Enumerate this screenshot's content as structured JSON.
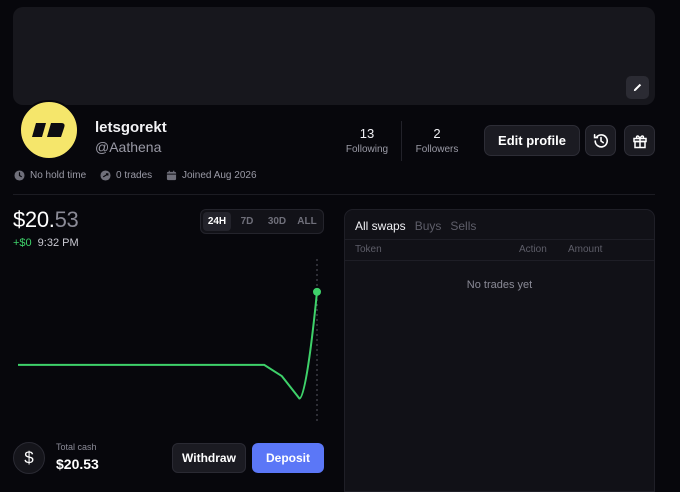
{
  "profile": {
    "username": "letsgorekt",
    "handle": "@Aathena",
    "following_count": "13",
    "following_label": "Following",
    "followers_count": "2",
    "followers_label": "Followers",
    "edit_profile_label": "Edit profile",
    "meta": {
      "hold_time": "No hold time",
      "trades": "0 trades",
      "joined": "Joined Aug 2026"
    }
  },
  "portfolio": {
    "balance_main": "$20.",
    "balance_cents": "53",
    "change": "+$0",
    "time": "9:32 PM",
    "range_options": [
      "24H",
      "7D",
      "30D",
      "ALL"
    ],
    "selected_range": "24H",
    "total_cash_label": "Total cash",
    "total_cash_value": "$20.53",
    "withdraw_label": "Withdraw",
    "deposit_label": "Deposit"
  },
  "chart_data": {
    "type": "line",
    "title": "",
    "series": [
      {
        "values": [
          20.4,
          20.4,
          20.4,
          20.4,
          20.4,
          20.4,
          20.4,
          20.4,
          20.4,
          20.4,
          20.4,
          20.4,
          20.4,
          20.4,
          20.4,
          20.38,
          20.34,
          20.53
        ]
      }
    ],
    "ylim": [
      20.3,
      20.56
    ],
    "grid": false,
    "line_color": "#3ed16a"
  },
  "swaps": {
    "tabs": [
      "All swaps",
      "Buys",
      "Sells"
    ],
    "active_tab": "All swaps",
    "columns": [
      "Token",
      "Action",
      "Amount"
    ],
    "empty_text": "No trades yet"
  },
  "colors": {
    "accent": "#5b77f7",
    "positive": "#3ed16a",
    "avatar_bg": "#f5e66b"
  }
}
